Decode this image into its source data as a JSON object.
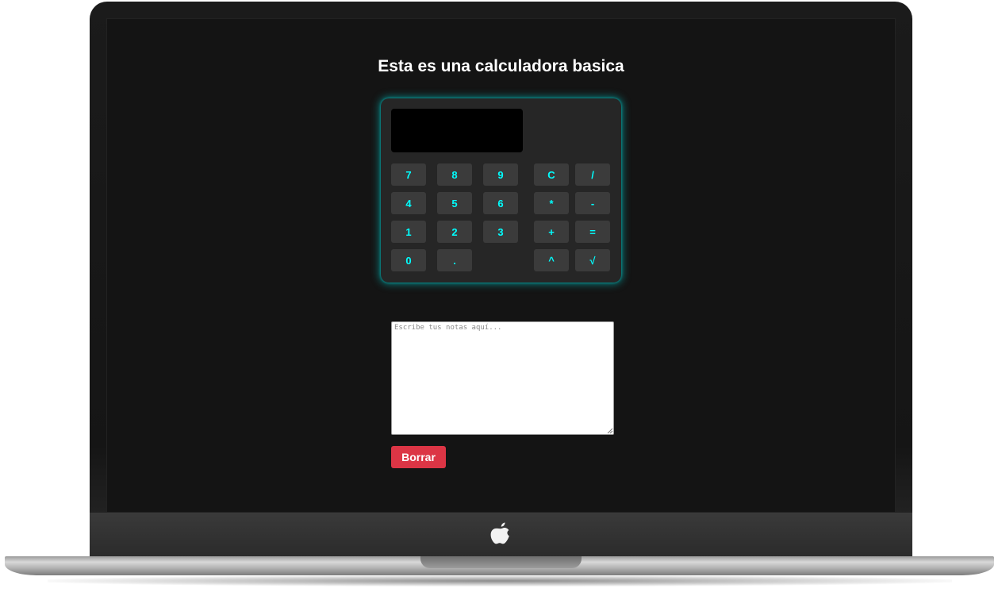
{
  "page": {
    "title": "Esta es una calculadora basica"
  },
  "calculator": {
    "display_value": "",
    "keys": {
      "k7": "7",
      "k8": "8",
      "k9": "9",
      "kc": "C",
      "kdiv": "/",
      "k4": "4",
      "k5": "5",
      "k6": "6",
      "kmul": "*",
      "ksub": "-",
      "k1": "1",
      "k2": "2",
      "k3": "3",
      "kadd": "+",
      "keq": "=",
      "k0": "0",
      "kdot": ".",
      "kpow": "^",
      "ksqrt": "√"
    }
  },
  "notes": {
    "placeholder": "Escribe tus notas aquí...",
    "value": ""
  },
  "clear_button": {
    "label": "Borrar"
  },
  "colors": {
    "accent": "#00ffff",
    "clear_button": "#dc3545",
    "background": "#141414"
  },
  "icons": {
    "device_logo": "apple-logo-icon"
  }
}
